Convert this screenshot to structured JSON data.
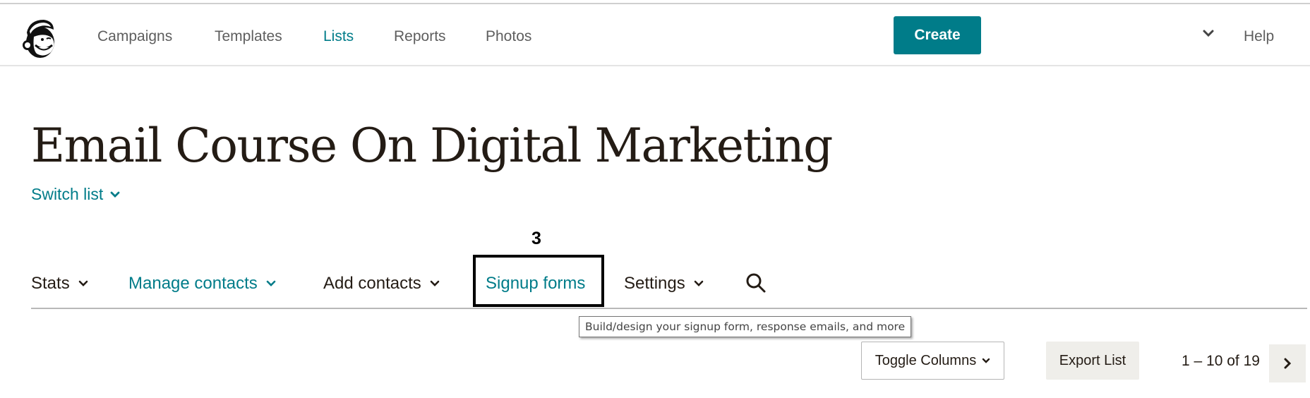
{
  "navbar": {
    "logo_alt": "Mailchimp Freddie logo",
    "items": [
      {
        "label": "Campaigns",
        "active": false
      },
      {
        "label": "Templates",
        "active": false
      },
      {
        "label": "Lists",
        "active": true
      },
      {
        "label": "Reports",
        "active": false
      },
      {
        "label": "Photos",
        "active": false
      }
    ],
    "create_label": "Create",
    "help_label": "Help"
  },
  "page": {
    "title": "Email Course On Digital Marketing",
    "switch_list_label": "Switch list"
  },
  "annotation": {
    "number": "3"
  },
  "subnav": {
    "items": [
      {
        "label": "Stats",
        "has_dropdown": true
      },
      {
        "label": "Manage contacts",
        "has_dropdown": true
      },
      {
        "label": "Add contacts",
        "has_dropdown": true
      },
      {
        "label": "Signup forms",
        "has_dropdown": false
      },
      {
        "label": "Settings",
        "has_dropdown": true
      }
    ],
    "search_icon": "search-icon"
  },
  "tooltip": {
    "text": "Build/design your signup form, response emails, and more"
  },
  "toolbar": {
    "toggle_columns_label": "Toggle Columns",
    "export_list_label": "Export List",
    "pagination_text": "1 – 10 of 19"
  },
  "colors": {
    "accent": "#007c89",
    "text": "#241c15",
    "muted": "#5e5e5e",
    "button_bg": "#efeeea"
  }
}
